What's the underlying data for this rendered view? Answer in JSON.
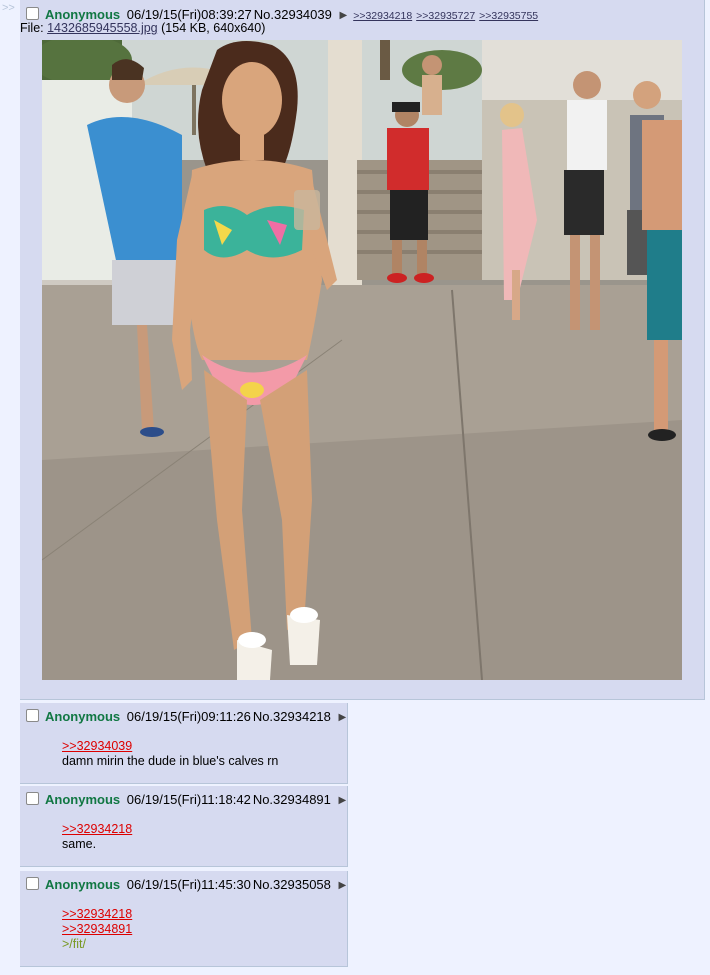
{
  "marker": ">>",
  "op": {
    "name": "Anonymous",
    "datetime": "06/19/15(Fri)08:39:27",
    "post_no": "No.32934039",
    "arrow": "▶",
    "backlinks": [
      ">>32934218",
      ">>32935727",
      ">>32935755"
    ],
    "file_label": "File:",
    "file_name": "1432685945558.jpg",
    "file_info": "(154 KB, 640x640)"
  },
  "replies": [
    {
      "name": "Anonymous",
      "datetime": "06/19/15(Fri)09:11:26",
      "post_no": "No.32934218",
      "arrow": "▶",
      "quotes": [
        ">>32934039"
      ],
      "text": "damn mirin the dude in blue's calves rn",
      "greentext": ""
    },
    {
      "name": "Anonymous",
      "datetime": "06/19/15(Fri)11:18:42",
      "post_no": "No.32934891",
      "arrow": "▶",
      "quotes": [
        ">>32934218"
      ],
      "text": "same.",
      "greentext": ""
    },
    {
      "name": "Anonymous",
      "datetime": "06/19/15(Fri)11:45:30",
      "post_no": "No.32935058",
      "arrow": "▶",
      "quotes": [
        ">>32934218",
        ">>32934891"
      ],
      "text": "",
      "greentext": ">/fit/"
    }
  ]
}
